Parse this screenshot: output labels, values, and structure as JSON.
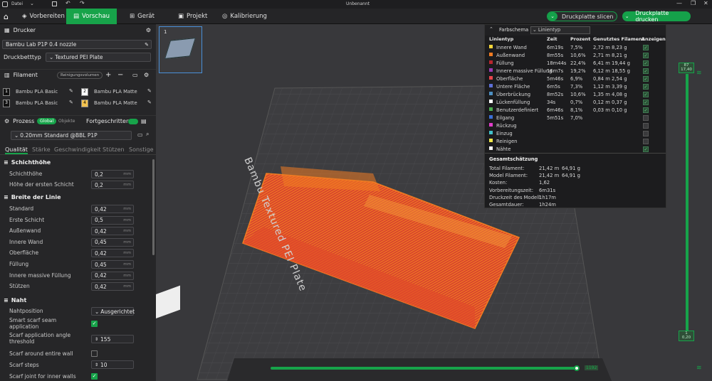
{
  "window": {
    "title": "Unbenannt",
    "file_menu": "Datei"
  },
  "tabs": [
    {
      "label": "Vorbereiten"
    },
    {
      "label": "Vorschau"
    },
    {
      "label": "Gerät"
    },
    {
      "label": "Projekt"
    },
    {
      "label": "Kalibrierung"
    }
  ],
  "actions": {
    "slice": "Druckplatte slicen",
    "print": "Druckplatte drucken"
  },
  "printer": {
    "section": "Drucker",
    "name": "Bambu Lab P1P 0.4 nozzle",
    "plate_label": "Druckbetttyp",
    "plate_value": "Textured PEI Plate"
  },
  "filament": {
    "section": "Filament",
    "purge_button": "Reinigungsvolumen",
    "slots": [
      {
        "num": "1",
        "name": "Bambu PLA Basic",
        "color": "#1a1a1a"
      },
      {
        "num": "2",
        "name": "Bambu PLA Matte",
        "color": "#ffffff"
      },
      {
        "num": "3",
        "name": "Bambu PLA Basic",
        "color": "#1a1a1a"
      },
      {
        "num": "4",
        "name": "Bambu PLA Matte",
        "color": "#f2c14e"
      }
    ]
  },
  "process": {
    "section": "Prozess",
    "global": "Global",
    "objects": "Objekte",
    "advanced": "Fortgeschritten",
    "preset": "0.20mm Standard @BBL P1P",
    "tabs": [
      "Qualität",
      "Stärke",
      "Geschwindigkeit",
      "Stützen",
      "Sonstige"
    ]
  },
  "settings": {
    "layer_height_header": "Schichthöhe",
    "layer_height": {
      "label": "Schichthöhe",
      "value": "0,2",
      "unit": "mm"
    },
    "first_layer": {
      "label": "Höhe der ersten Schicht",
      "value": "0,2",
      "unit": "mm"
    },
    "line_width_header": "Breite der Linie",
    "widths": [
      {
        "label": "Standard",
        "value": "0,42",
        "unit": "mm"
      },
      {
        "label": "Erste Schicht",
        "value": "0,5",
        "unit": "mm"
      },
      {
        "label": "Außenwand",
        "value": "0,42",
        "unit": "mm"
      },
      {
        "label": "Innere Wand",
        "value": "0,45",
        "unit": "mm"
      },
      {
        "label": "Oberfläche",
        "value": "0,42",
        "unit": "mm"
      },
      {
        "label": "Füllung",
        "value": "0,45",
        "unit": "mm"
      },
      {
        "label": "Innere massive Füllung",
        "value": "0,42",
        "unit": "mm"
      },
      {
        "label": "Stützen",
        "value": "0,42",
        "unit": "mm"
      }
    ],
    "seam_header": "Naht",
    "seam_position": {
      "label": "Nahtposition",
      "value": "Ausgerichtet"
    },
    "smart_scarf": {
      "label": "Smart scarf seam application",
      "checked": true
    },
    "scarf_threshold": {
      "label": "Scarf application angle threshold",
      "value": "155"
    },
    "scarf_entire": {
      "label": "Scarf around entire wall",
      "checked": false
    },
    "scarf_steps": {
      "label": "Scarf steps",
      "value": "10"
    },
    "scarf_inner": {
      "label": "Scarf joint for inner walls",
      "checked": true
    }
  },
  "plate_thumb": {
    "number": "1"
  },
  "bed_label": "Bambu Textured PEI Plate",
  "layer_slider": {
    "top": "87",
    "top_height": "17,40",
    "bottom": "1",
    "bottom_height": "0,20"
  },
  "move_slider": {
    "value": "1192",
    "position": 1.0
  },
  "legend": {
    "title": "Farbschema",
    "dropdown": "Linientyp",
    "columns": [
      "Linientyp",
      "Zeit",
      "Prozent",
      "Genutztes Filament",
      "Anzeigen"
    ],
    "rows": [
      {
        "name": "Innere Wand",
        "color": "#f5d53a",
        "time": "6m19s",
        "pct": "7,5%",
        "len": "2,72 m",
        "weight": "8,23 g",
        "show": true
      },
      {
        "name": "Außenwand",
        "color": "#f07b22",
        "time": "8m55s",
        "pct": "10,6%",
        "len": "2,71 m",
        "weight": "8,21 g",
        "show": true
      },
      {
        "name": "Füllung",
        "color": "#b8262e",
        "time": "18m44s",
        "pct": "22,4%",
        "len": "6,41 m",
        "weight": "19,44 g",
        "show": true
      },
      {
        "name": "Innere massive Füllung",
        "color": "#9b3cb5",
        "time": "16m7s",
        "pct": "19,2%",
        "len": "6,12 m",
        "weight": "18,55 g",
        "show": true
      },
      {
        "name": "Oberfläche",
        "color": "#e8454b",
        "time": "5m46s",
        "pct": "6,9%",
        "len": "0,84 m",
        "weight": "2,54 g",
        "show": true
      },
      {
        "name": "Untere Fläche",
        "color": "#5d6fd6",
        "time": "6m5s",
        "pct": "7,3%",
        "len": "1,12 m",
        "weight": "3,39 g",
        "show": true
      },
      {
        "name": "Überbrückung",
        "color": "#4d8fc2",
        "time": "8m52s",
        "pct": "10,6%",
        "len": "1,35 m",
        "weight": "4,08 g",
        "show": true
      },
      {
        "name": "Lückenfüllung",
        "color": "#ffffff",
        "time": "34s",
        "pct": "0,7%",
        "len": "0,12 m",
        "weight": "0,37 g",
        "show": true
      },
      {
        "name": "Benutzerdefiniert",
        "color": "#4caf50",
        "time": "6m46s",
        "pct": "8,1%",
        "len": "0,03 m",
        "weight": "0,10 g",
        "show": true
      },
      {
        "name": "Eilgang",
        "color": "#3b6fd6",
        "time": "5m51s",
        "pct": "7,0%",
        "len": "",
        "weight": "",
        "show": false
      },
      {
        "name": "Rückzug",
        "color": "#e03ec9",
        "time": "",
        "pct": "",
        "len": "",
        "weight": "",
        "show": false
      },
      {
        "name": "Einzug",
        "color": "#41c0c8",
        "time": "",
        "pct": "",
        "len": "",
        "weight": "",
        "show": false
      },
      {
        "name": "Reinigen",
        "color": "#f0e84a",
        "time": "",
        "pct": "",
        "len": "",
        "weight": "",
        "show": false
      },
      {
        "name": "Nähte",
        "color": "#f2f2f2",
        "time": "",
        "pct": "",
        "len": "",
        "weight": "",
        "show": true
      }
    ],
    "estimate_title": "Gesamtschätzung",
    "estimates": [
      {
        "label": "Total Filament:",
        "a": "21,42 m",
        "b": "64,91 g"
      },
      {
        "label": "Model Filament:",
        "a": "21,42 m",
        "b": "64,91 g"
      },
      {
        "label": "Kosten:",
        "a": "1,62",
        "b": ""
      },
      {
        "label": "Vorbereitungszeit:",
        "a": "6m31s",
        "b": ""
      },
      {
        "label": "Druckzeit des Modell:",
        "a": "1h17m",
        "b": ""
      },
      {
        "label": "Gesamtdauer:",
        "a": "1h24m",
        "b": ""
      }
    ]
  }
}
